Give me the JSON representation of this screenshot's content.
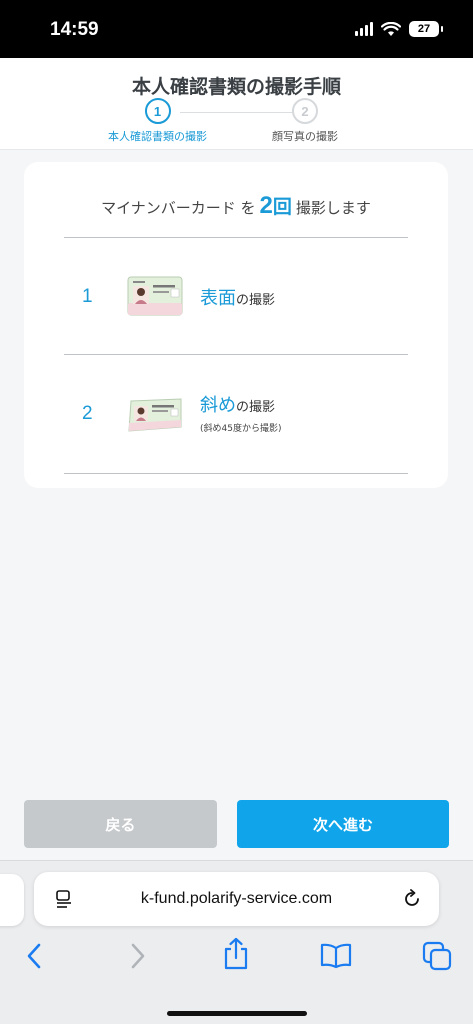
{
  "status_bar": {
    "time": "14:59",
    "battery": "27"
  },
  "header": {
    "title": "本人確認書類の撮影手順",
    "steps": [
      {
        "number": "1",
        "label": "本人確認書類の撮影"
      },
      {
        "number": "2",
        "label": "顔写真の撮影"
      }
    ]
  },
  "card": {
    "heading_prefix": "マイナンバーカード を",
    "heading_count": "2",
    "heading_count_unit": "回",
    "heading_suffix": "撮影します",
    "rows": [
      {
        "number": "1",
        "highlight": "表面",
        "text": "の撮影",
        "note": ""
      },
      {
        "number": "2",
        "highlight": "斜め",
        "text": "の撮影",
        "note": "(斜め45度から撮影)"
      }
    ]
  },
  "buttons": {
    "back": "戻る",
    "next": "次へ進む"
  },
  "browser": {
    "url": "k-fund.polarify-service.com"
  },
  "colors": {
    "accent": "#1a9ad6",
    "next_button": "#10a5ea",
    "back_button": "#c6c9cc"
  }
}
